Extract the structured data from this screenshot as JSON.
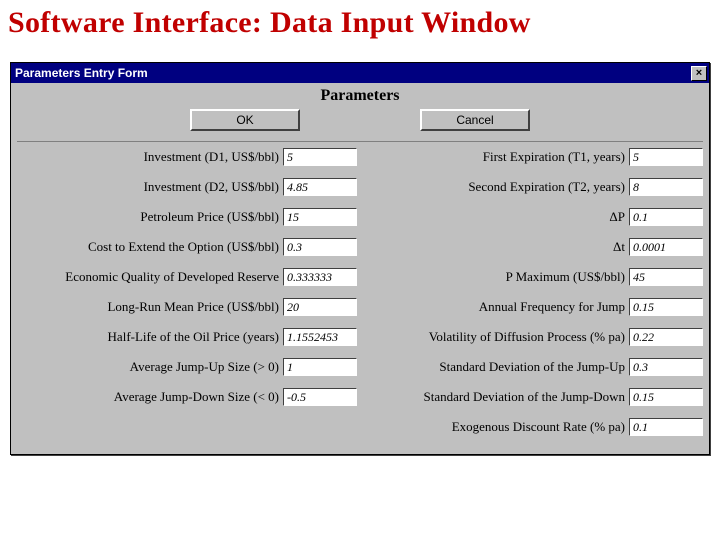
{
  "page": {
    "title": "Software Interface: Data Input Window"
  },
  "window": {
    "title": "Parameters Entry Form",
    "close_glyph": "×",
    "heading": "Parameters",
    "buttons": {
      "ok": "OK",
      "cancel": "Cancel"
    }
  },
  "fields": {
    "investment_d1": {
      "label": "Investment (D1, US$/bbl)",
      "value": "5"
    },
    "first_exp": {
      "label": "First Expiration (T1, years)",
      "value": "5"
    },
    "investment_d2": {
      "label": "Investment (D2, US$/bbl)",
      "value": "4.85"
    },
    "second_exp": {
      "label": "Second Expiration (T2, years)",
      "value": "8"
    },
    "petrol_price": {
      "label": "Petroleum Price (US$/bbl)",
      "value": "15"
    },
    "delta_p": {
      "label": "ΔP",
      "value": "0.1"
    },
    "extend_cost": {
      "label": "Cost to Extend the Option (US$/bbl)",
      "value": "0.3"
    },
    "delta_t": {
      "label": "Δt",
      "value": "0.0001"
    },
    "econ_quality": {
      "label": "Economic Quality of Developed Reserve",
      "value": "0.333333"
    },
    "p_max": {
      "label": "P Maximum (US$/bbl)",
      "value": "45"
    },
    "long_run_mean": {
      "label": "Long-Run Mean Price (US$/bbl)",
      "value": "20"
    },
    "jump_freq": {
      "label": "Annual Frequency for Jump",
      "value": "0.15"
    },
    "half_life": {
      "label": "Half-Life of the Oil Price (years)",
      "value": "1.1552453"
    },
    "diffusion_vol": {
      "label": "Volatility of Diffusion Process (% pa)",
      "value": "0.22"
    },
    "jump_up_size": {
      "label": "Average Jump-Up Size (> 0)",
      "value": "1"
    },
    "jump_up_sd": {
      "label": "Standard Deviation of the Jump-Up",
      "value": "0.3"
    },
    "jump_down_size": {
      "label": "Average Jump-Down Size (< 0)",
      "value": "-0.5"
    },
    "jump_down_sd": {
      "label": "Standard Deviation of the Jump-Down",
      "value": "0.15"
    },
    "discount_rate": {
      "label": "Exogenous Discount Rate (% pa)",
      "value": "0.1"
    }
  }
}
